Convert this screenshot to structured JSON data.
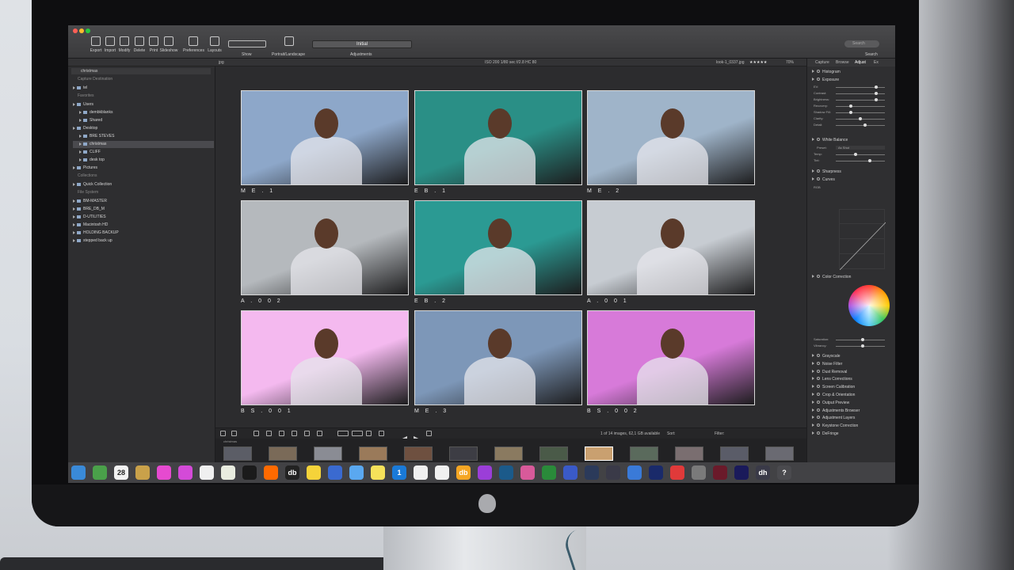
{
  "toolbar": {
    "items": [
      {
        "label": "Export",
        "icon": "export-icon"
      },
      {
        "label": "Import",
        "icon": "import-icon"
      },
      {
        "label": "Modify",
        "icon": "modify-icon"
      },
      {
        "label": "Delete",
        "icon": "delete-icon"
      },
      {
        "label": "Print",
        "icon": "print-icon"
      },
      {
        "label": "Slideshow",
        "icon": "slideshow-icon"
      },
      {
        "label": "Preferences",
        "icon": "preferences-icon"
      },
      {
        "label": "Layouts",
        "icon": "layouts-icon"
      }
    ],
    "show_label": "Show",
    "portrait_label": "Portrait/Landscape",
    "preset_value": "Initial",
    "adjustments_label": "Adjustments",
    "search_placeholder": "Search",
    "search_label": "Search"
  },
  "infobar": {
    "file_ext": "jpg",
    "exif": "ISO 200  1/80 sec  f/2.8  HC 80",
    "filename": "look-1_0337.jpg",
    "zoom": "70%"
  },
  "sidebar": {
    "library_dropdown": "christmas",
    "rows": [
      {
        "text": "Capture Destination",
        "type": "head"
      },
      {
        "text": "tel",
        "type": "item"
      },
      {
        "text": "Favorites",
        "type": "head"
      },
      {
        "text": "Users",
        "type": "item"
      },
      {
        "text": "dembkblanks",
        "type": "child"
      },
      {
        "text": "Shared",
        "type": "child"
      },
      {
        "text": "Desktop",
        "type": "item"
      },
      {
        "text": "BRE STEVES",
        "type": "child"
      },
      {
        "text": "christmas",
        "type": "child-selected"
      },
      {
        "text": "CLIFF",
        "type": "child"
      },
      {
        "text": "desk top",
        "type": "child"
      },
      {
        "text": "Pictures",
        "type": "item"
      },
      {
        "text": "Collections",
        "type": "head"
      },
      {
        "text": "Quick Collection",
        "type": "item"
      },
      {
        "text": "File System",
        "type": "head"
      },
      {
        "text": "BM-MASTER",
        "type": "item"
      },
      {
        "text": "BRE_DB_M",
        "type": "item"
      },
      {
        "text": "D-UTILITIES",
        "type": "item"
      },
      {
        "text": "Macintosh HD",
        "type": "item"
      },
      {
        "text": "HOLDING BACKUP",
        "type": "item"
      },
      {
        "text": "stepped back up",
        "type": "item"
      }
    ]
  },
  "grid": {
    "cells": [
      {
        "label": "M E . 1",
        "bg": "#8da7c9"
      },
      {
        "label": "E B . 1",
        "bg": "#2a8f86"
      },
      {
        "label": "M E . 2",
        "bg": "#9fb4c9"
      },
      {
        "label": "A . 0 0 2",
        "bg": "#b5b9bd"
      },
      {
        "label": "E B . 2",
        "bg": "#2b9a93"
      },
      {
        "label": "A . 0 0 1",
        "bg": "#c7ccd2"
      },
      {
        "label": "B S . 0 0 1",
        "bg": "#f4b9ef"
      },
      {
        "label": "M E . 3",
        "bg": "#7d97b8"
      },
      {
        "label": "B S . 0 0 2",
        "bg": "#d77ad9"
      }
    ]
  },
  "rpanel": {
    "tabs": [
      "Capture",
      "Browse",
      "Adjust",
      "Ex"
    ],
    "active_tab": "Adjust",
    "sections_top": [
      "Histogram",
      "Exposure"
    ],
    "exposure_sliders": [
      "EV:",
      "Contrast:",
      "Brightness:",
      "Recovery:",
      "Shadow Fill:",
      "Clarity:",
      "Detail:"
    ],
    "white_balance": "White Balance",
    "wb_rows": [
      "Preset:",
      "Temp:",
      "Tint:"
    ],
    "wb_preset": "As Shot",
    "sharpness": "Sharpness",
    "curves": "Curves",
    "curves_channel": "RGB",
    "color_correction": "Color Correction",
    "cc_sliders": [
      "Saturation:",
      "Vibrancy:"
    ],
    "sections_bottom": [
      "Grayscale",
      "Noise Filter",
      "Dust Removal",
      "Lens Corrections",
      "Screen Calibration",
      "Crop & Orientation",
      "Output Preview",
      "Adjustments Browser",
      "Adjustment Layers",
      "Keystone Correction",
      "DeFringe"
    ]
  },
  "toolstrip": {
    "status": "1 of 14 images, 62,1 GB available",
    "sort_label": "Sort:",
    "filter_label": "Filter:"
  },
  "filmstrip": {
    "label": "christmas",
    "thumbs": [
      "#5b5d66",
      "#7a6a58",
      "#8a8c94",
      "#9a7a5a",
      "#6e5040",
      "#3d3d44",
      "#8a7a60",
      "#4a5a48",
      "#c9a070",
      "#5a6a5c",
      "#7a6e70",
      "#5a5c68",
      "#6a6a72"
    ]
  },
  "dock": {
    "icons": [
      {
        "name": "finder",
        "color": "#3a8ad8"
      },
      {
        "name": "safari",
        "color": "#4aa04a"
      },
      {
        "name": "calendar",
        "color": "#f2f2f2",
        "text": "28"
      },
      {
        "name": "notes",
        "color": "#c9a14a"
      },
      {
        "name": "photos",
        "color": "#e64ad0"
      },
      {
        "name": "itunes",
        "color": "#d44ad8"
      },
      {
        "name": "textedit",
        "color": "#f0f0f0"
      },
      {
        "name": "preview",
        "color": "#e9ecdf"
      },
      {
        "name": "terminal",
        "color": "#1b1b1b"
      },
      {
        "name": "firefox",
        "color": "#ff6a00"
      },
      {
        "name": "db",
        "color": "#222",
        "text": "db"
      },
      {
        "name": "stickies",
        "color": "#f5d33a"
      },
      {
        "name": "xcode",
        "color": "#3a6ad0"
      },
      {
        "name": "mail",
        "color": "#5aa8f0"
      },
      {
        "name": "notepad",
        "color": "#f5e15a"
      },
      {
        "name": "1password",
        "color": "#1a7ad8",
        "text": "1"
      },
      {
        "name": "chrome",
        "color": "#f0f0f0"
      },
      {
        "name": "word",
        "color": "#f0f0f0"
      },
      {
        "name": "plexus",
        "color": "#f5a623",
        "text": "db"
      },
      {
        "name": "purple-app",
        "color": "#9b3ed8"
      },
      {
        "name": "vm",
        "color": "#1b5a8a"
      },
      {
        "name": "pink-app",
        "color": "#d85a9a"
      },
      {
        "name": "green-app",
        "color": "#2a8a3a"
      },
      {
        "name": "blue-app",
        "color": "#3a5ac8"
      },
      {
        "name": "star-app",
        "color": "#2b3a5a"
      },
      {
        "name": "dark-app",
        "color": "#3a3a48"
      },
      {
        "name": "mail-app",
        "color": "#3a7ad8"
      },
      {
        "name": "navy-app",
        "color": "#1a2a6a"
      },
      {
        "name": "red-blue-app",
        "color": "#e03a3a"
      },
      {
        "name": "grey-app",
        "color": "#7a7a7a"
      },
      {
        "name": "maroon-app",
        "color": "#6a1a2a"
      },
      {
        "name": "navy2-app",
        "color": "#1a1a5a"
      },
      {
        "name": "dh-app",
        "color": "#3a3a48",
        "text": "dh"
      },
      {
        "name": "help-app",
        "color": "#4a4a4e",
        "text": "?"
      }
    ]
  }
}
